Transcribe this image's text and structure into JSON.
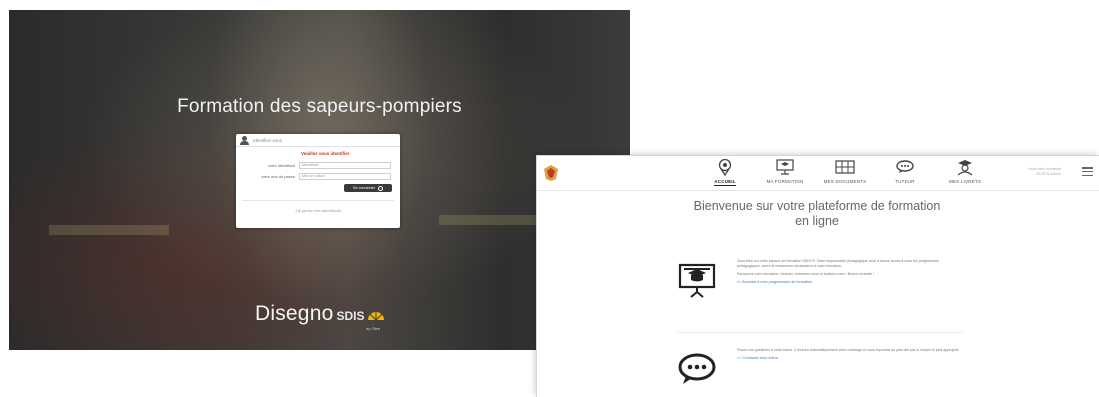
{
  "login": {
    "title": "Formation des sapeurs-pompiers",
    "box_header": "Identifiez-vous",
    "error_message": "Veuillez vous identifier",
    "identifier_label": "votre identifiant",
    "identifier_placeholder": "Identifiant",
    "password_label": "votre mot de passe",
    "password_placeholder": "Mot de passe",
    "connect_button": "Se connecter",
    "forgot_link": "J'ai perdu mes identifiants",
    "brand_name": "Disegno",
    "brand_sub": "SDIS",
    "brand_by": "by Ofee",
    "brand_color": "#f2b705"
  },
  "dashboard": {
    "nav": [
      {
        "label": "ACCUEIL",
        "icon": "map-pin-icon",
        "active": true
      },
      {
        "label": "MA FORMATION",
        "icon": "presentation-icon",
        "active": false
      },
      {
        "label": "MES DOCUMENTS",
        "icon": "documents-icon",
        "active": false
      },
      {
        "label": "TUTEUR",
        "icon": "chat-icon",
        "active": false
      },
      {
        "label": "MES LIVRETS",
        "icon": "graduate-icon",
        "active": false
      }
    ],
    "user_line1": "Vous êtes connecté",
    "user_line2": "SDIS75 Admin",
    "welcome_title": "Bienvenue sur votre plateforme de formation en ligne",
    "section1": {
      "icon": "teaching-board-icon",
      "paragraph1": "Vous êtes sur votre espace de formation SDIS75. Votre responsable pédagogique vous a donné accès à vous les programmes pédagogiques, cours et ressources nécessaires à votre formation.",
      "paragraph2": "Parcourez votre formation, réussez, entraînez-vous et évaluez-vous ! Bonne réussite !",
      "link": ">> Accéder à mes programmes de formation"
    },
    "section2": {
      "icon": "speech-bubble-icon",
      "paragraph1": "Posez vos questions à votre tuteur. Il recevra automatiquement votre message et vous répondra au plus vite par le moyen le plus approprié.",
      "link": ">> Contacter mon tuteur"
    }
  }
}
